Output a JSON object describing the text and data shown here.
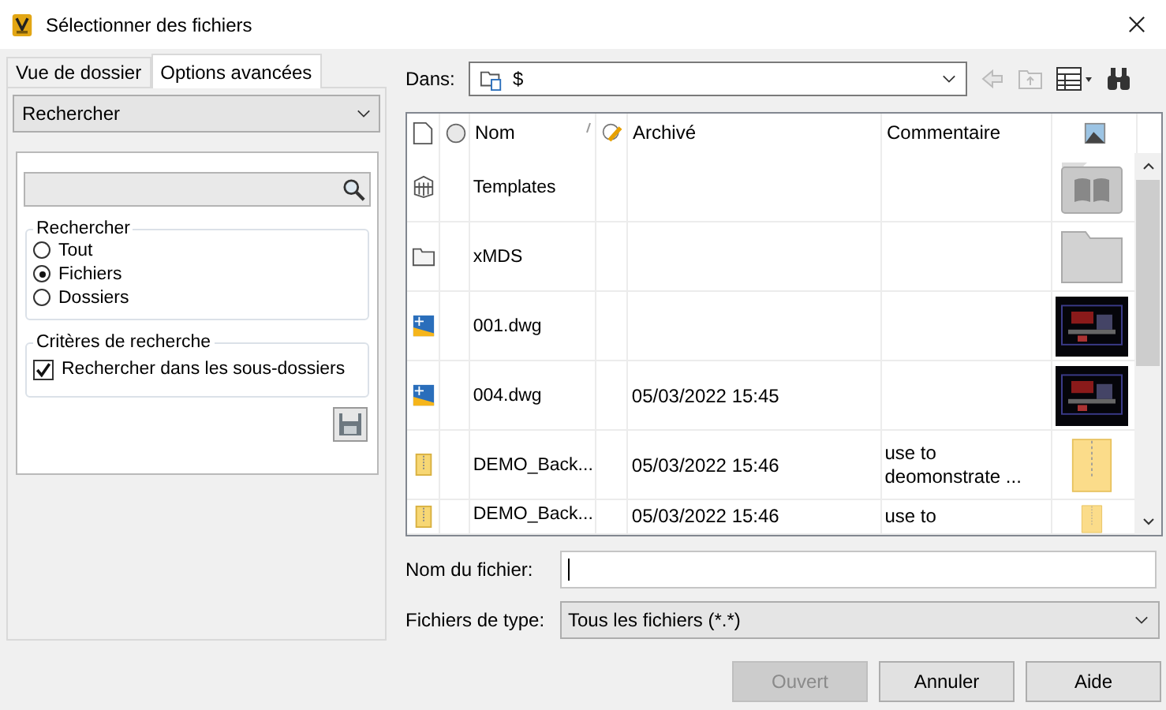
{
  "window": {
    "title": "Sélectionner des fichiers"
  },
  "tabs": [
    {
      "label": "Vue de dossier",
      "selected": false
    },
    {
      "label": "Options avancées",
      "selected": true
    }
  ],
  "search_panel": {
    "mode": "Rechercher",
    "group_title": "Rechercher",
    "options": [
      {
        "label": "Tout",
        "selected": false
      },
      {
        "label": "Fichiers",
        "selected": true
      },
      {
        "label": "Dossiers",
        "selected": false
      }
    ],
    "criteria_title": "Critères de recherche",
    "criteria": [
      {
        "label": "Rechercher dans les sous-dossiers",
        "checked": true
      }
    ]
  },
  "location": {
    "label": "Dans:",
    "value": "$"
  },
  "table": {
    "columns": [
      "Nom",
      "Archivé",
      "Commentaire"
    ],
    "rows": [
      {
        "kind": "library",
        "name": "Templates"
      },
      {
        "kind": "folder",
        "name": "xMDS"
      },
      {
        "kind": "dwg",
        "name": "001.dwg"
      },
      {
        "kind": "dwg",
        "name": "004.dwg",
        "archived": "05/03/2022 15:45"
      },
      {
        "kind": "zip",
        "name": "DEMO_Back...",
        "archived": "05/03/2022 15:46",
        "comment": "use to deomonstrate ..."
      },
      {
        "kind": "zip",
        "name": "DEMO_Back...",
        "archived": "05/03/2022 15:46",
        "comment": "use to"
      }
    ]
  },
  "file_name": {
    "label": "Nom du fichier:"
  },
  "file_type": {
    "label": "Fichiers de type:",
    "value": "Tous les fichiers (*.*)"
  },
  "buttons": [
    {
      "label": "Ouvert",
      "disabled": true
    },
    {
      "label": "Annuler",
      "disabled": false
    },
    {
      "label": "Aide",
      "disabled": false
    }
  ]
}
